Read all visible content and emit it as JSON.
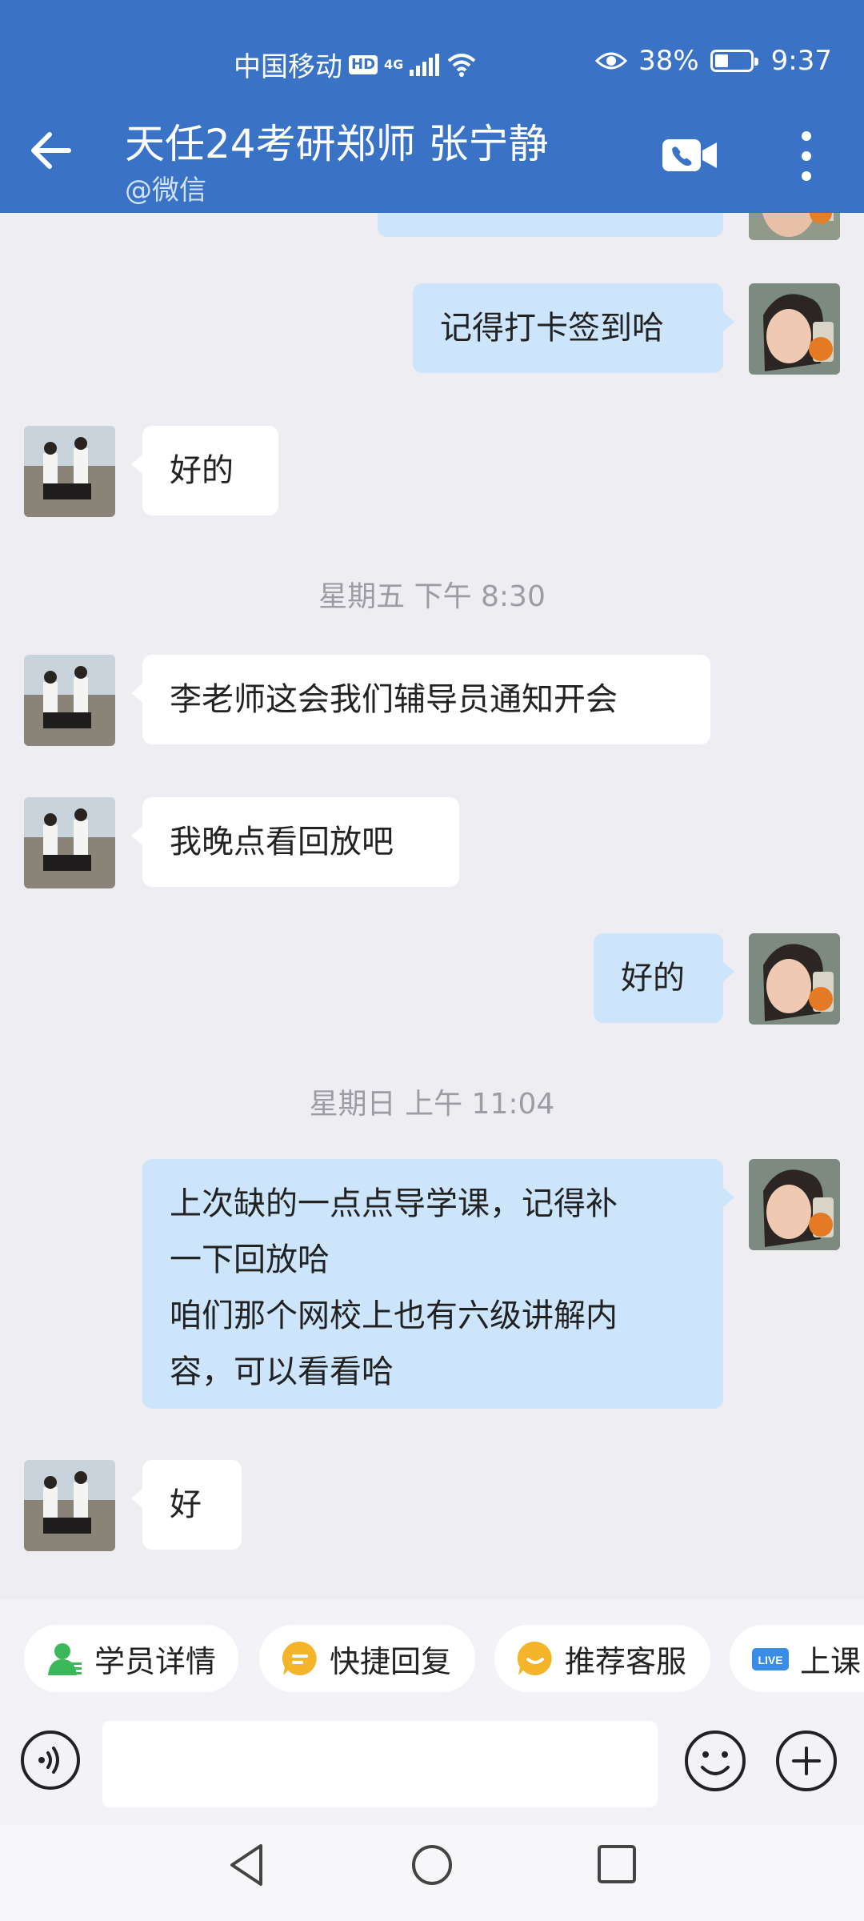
{
  "status_bar": {
    "carrier": "中国移动",
    "hd_label": "HD",
    "network": "4G",
    "battery": "38%",
    "time": "9:37"
  },
  "header": {
    "title": "天任24考研郑师 张宁静",
    "subtitle": "@微信"
  },
  "chat": {
    "messages": [
      {
        "side": "out",
        "text": "记得打卡签到哈"
      },
      {
        "side": "in",
        "text": "好的"
      },
      {
        "side": "in",
        "text": "李老师这会我们辅导员通知开会"
      },
      {
        "side": "in",
        "text": "我晚点看回放吧"
      },
      {
        "side": "out",
        "text": "好的"
      },
      {
        "side": "out",
        "text_lines": [
          "上次缺的一点点导学课，记得补",
          "一下回放哈",
          "咱们那个网校上也有六级讲解内",
          "容，可以看看哈"
        ]
      },
      {
        "side": "in",
        "text": "好"
      }
    ],
    "timestamps": [
      "星期五  下午 8:30",
      "星期日  上午 11:04"
    ]
  },
  "quick_actions": [
    {
      "label": "学员详情",
      "icon": "user-icon",
      "color": "#3bb85a"
    },
    {
      "label": "快捷回复",
      "icon": "reply-icon",
      "color": "#f5b52a"
    },
    {
      "label": "推荐客服",
      "icon": "service-icon",
      "color": "#f5b52a"
    },
    {
      "label": "上课",
      "icon": "live-icon",
      "color": "#3a8de6",
      "badge": "LIVE"
    }
  ],
  "input": {
    "value": "",
    "placeholder": ""
  },
  "colors": {
    "header": "#3a73c6",
    "bubble_out": "#cce5fb",
    "bubble_in": "#ffffff",
    "background": "#ededf2"
  }
}
